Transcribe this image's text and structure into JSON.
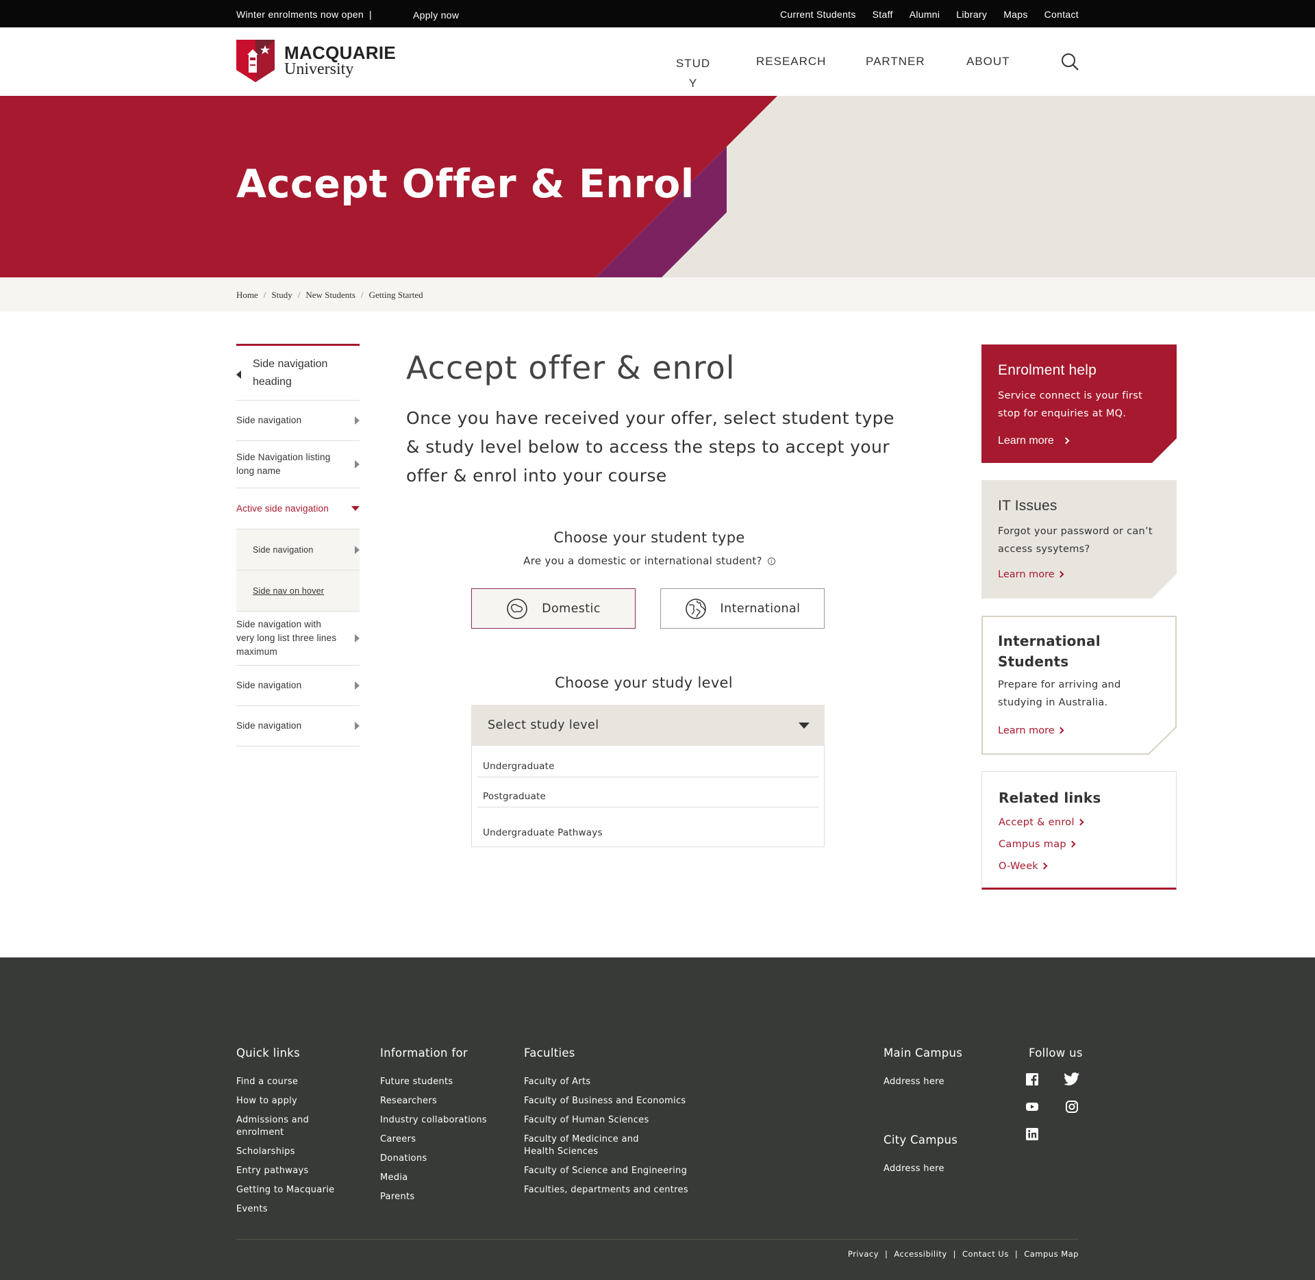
{
  "topbar": {
    "announcement": "Winter enrolments now open",
    "separator": "|",
    "apply": "Apply now",
    "links": [
      "Current Students",
      "Staff",
      "Alumni",
      "Library",
      "Maps",
      "Contact"
    ]
  },
  "header": {
    "logo_line1": "MACQUARIE",
    "logo_line2": "University",
    "nav": [
      "STUDY",
      "RESEARCH",
      "PARTNER",
      "ABOUT"
    ],
    "search_icon": "search-icon"
  },
  "hero": {
    "title": "Accept Offer & Enrol",
    "colors": {
      "red": "#a6192e",
      "purple": "#7d2260",
      "sand": "#e8e5df"
    }
  },
  "breadcrumb": [
    "Home",
    "Study",
    "New Students",
    "Getting Started"
  ],
  "sidenav": {
    "heading": "Side navigation heading",
    "items": [
      {
        "label": "Side navigation"
      },
      {
        "label": "Side Navigation listing long name"
      },
      {
        "label": "Active side navigation"
      },
      {
        "label": "Side navigation"
      },
      {
        "label": "Side nav on hover"
      },
      {
        "label": "Side navigation with very long list three lines maximum"
      },
      {
        "label": "Side navigation"
      },
      {
        "label": "Side navigation"
      }
    ]
  },
  "main": {
    "title": "Accept offer & enrol",
    "intro": "Once you have received your offer, select student type & study level below to access the steps to accept your offer & enrol into your course",
    "student_type": {
      "title": "Choose your student type",
      "subtitle": "Are you a domestic or international student?",
      "options": [
        "Domestic",
        "International"
      ],
      "selected": "Domestic"
    },
    "study_level": {
      "title": "Choose your study level",
      "placeholder": "Select study level",
      "options": [
        "Undergraduate",
        "Postgraduate",
        "Undergraduate Pathways"
      ]
    }
  },
  "cards": {
    "enrolment_help": {
      "title": "Enrolment help",
      "text": "Service connect is your first stop for enquiries at MQ.",
      "link": "Learn more"
    },
    "it_issues": {
      "title": "IT Issues",
      "text": "Forgot your password or can’t access sysytems?",
      "link": "Learn more"
    },
    "international": {
      "title": "International Students",
      "text": "Prepare for arriving and studying in Australia.",
      "link": "Learn more"
    },
    "related": {
      "title": "Related links",
      "links": [
        "Accept & enrol",
        "Campus map",
        "O-Week"
      ]
    }
  },
  "footer": {
    "quick_links": {
      "title": "Quick links",
      "items": [
        "Find a course",
        "How to apply",
        "Admissions and enrolment",
        "Scholarships",
        "Entry pathways",
        "Getting to Macquarie",
        "Events"
      ]
    },
    "information_for": {
      "title": "Information for",
      "items": [
        "Future students",
        "Researchers",
        "Industry collaborations",
        "Careers",
        "Donations",
        "Media",
        "Parents"
      ]
    },
    "faculties": {
      "title": "Faculties",
      "items": [
        "Faculty of Arts",
        "Faculty of Business and Economics",
        "Faculty of Human Sciences",
        "Faculty of Medicince and Health Sciences",
        "Faculty of Science and Engineering",
        "Faculties, departments and centres"
      ]
    },
    "main_campus": {
      "title": "Main Campus",
      "address": "Address here"
    },
    "city_campus": {
      "title": "City Campus",
      "address": "Address here"
    },
    "follow": {
      "title": "Follow us",
      "icons": [
        "facebook-icon",
        "twitter-icon",
        "youtube-icon",
        "instagram-icon",
        "linkedin-icon"
      ]
    },
    "bottom_links": [
      "Privacy",
      "Accessibility",
      "Contact Us",
      "Campus Map"
    ]
  }
}
